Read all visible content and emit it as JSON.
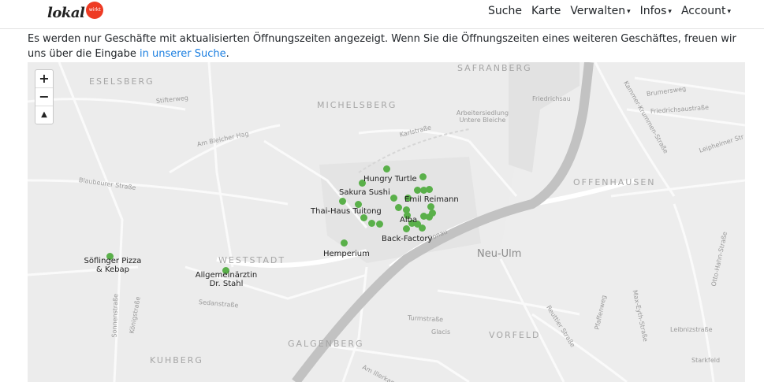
{
  "nav": {
    "logo_text": "lokal",
    "logo_badge": "wirkt",
    "items": [
      "Suche",
      "Karte",
      "Verwalten",
      "Infos",
      "Account"
    ],
    "dropdown_caret": "▾"
  },
  "info": {
    "text": "Es werden nur Geschäfte mit aktualisierten Öffnungszeiten angezeigt. Wenn Sie die Öffnungszeiten eines weiteren Geschäftes, freuen wir uns über die Eingabe ",
    "link": "in unserer Suche",
    "tail": "."
  },
  "map": {
    "zoom_in": "+",
    "zoom_out": "−",
    "locate": "▲",
    "areas": [
      "ESELSBERG",
      "MICHELSBERG",
      "SAFRANBERG",
      "OFFENHAUSEN",
      "WESTSTADT",
      "KUHBERG",
      "GALGENBERG",
      "VORFELD"
    ],
    "city": "Neu-Ulm",
    "streets": [
      "Stifterweg",
      "Am Bleicher Hag",
      "Blaubeurer Straße",
      "Karlstraße",
      "Arbeitersiedlung Untere Bleiche",
      "Friedrichsau",
      "Brumersweg",
      "Friedrichsaustraße",
      "Leipheimer Str",
      "Kammer-Krummen-Straße",
      "Sedanstraße",
      "Sonnenstraße",
      "Königstraße",
      "Turmstraße",
      "Glacis",
      "Reuttier Straße",
      "Pfaffenweg",
      "Max-Eyth-Straße",
      "Leibnizstraße",
      "Otto-Hahn-Straße",
      "Starkfeld",
      "Am Illerkanal",
      "Donau"
    ],
    "stores": [
      "Hungry Turtle",
      "Sakura Sushi",
      "Emil Reimann",
      "Thai-Haus Tuitong",
      "Alba",
      "Back-Factory",
      "Hemperium",
      "Söflinger Pizza & Kebap",
      "Allgemeinärztin Dr. Stahl"
    ],
    "marker_color": "#5ab04a"
  }
}
